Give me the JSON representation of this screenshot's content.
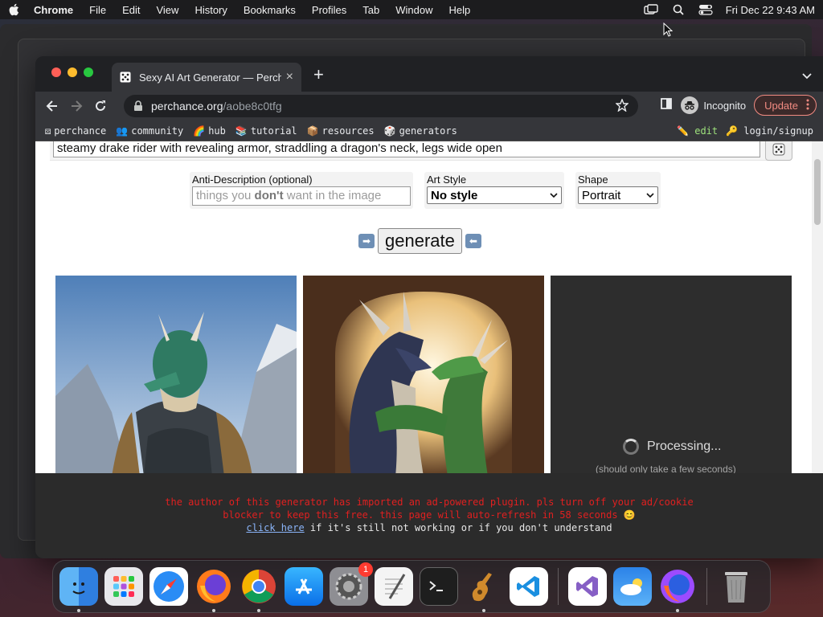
{
  "menubar": {
    "app_name": "Chrome",
    "items": [
      "File",
      "Edit",
      "View",
      "History",
      "Bookmarks",
      "Profiles",
      "Tab",
      "Window",
      "Help"
    ],
    "clock": "Fri Dec 22  9:43 AM"
  },
  "browser": {
    "tab_title": "Sexy AI Art Generator — Perch",
    "url_host": "perchance.org",
    "url_path": "/aobe8c0tfg",
    "incognito_label": "Incognito",
    "update_label": "Update"
  },
  "bookmarks": {
    "items": [
      {
        "emoji": "⚄",
        "label": "perchance"
      },
      {
        "emoji": "👥",
        "label": "community"
      },
      {
        "emoji": "🌈",
        "label": "hub"
      },
      {
        "emoji": "📚",
        "label": "tutorial"
      },
      {
        "emoji": "📦",
        "label": "resources"
      },
      {
        "emoji": "🎲",
        "label": "generators"
      }
    ],
    "edit": "✏️ edit",
    "login": "🔑 login/signup"
  },
  "page": {
    "prompt_value": "steamy drake rider with revealing armor, straddling a dragon's neck, legs wide open",
    "anti_label": "Anti-Description (optional)",
    "anti_placeholder_before": "things you ",
    "anti_placeholder_bold": "don't",
    "anti_placeholder_after": " want in the image",
    "style_label": "Art Style",
    "style_value": "No style",
    "shape_label": "Shape",
    "shape_value": "Portrait",
    "generate_label": "generate",
    "processing_label": "Processing...",
    "processing_sub": "(should only take a few seconds)"
  },
  "notice": {
    "line1": "the author of this generator has imported an ad-powered plugin. pls turn off your ad/cookie",
    "line2": "blocker to keep this free. this page will auto-refresh in 58 seconds 😊",
    "link": "click here",
    "line3_rest": " if it's still not working or if you don't understand"
  },
  "dock": {
    "apps": [
      "finder-icon",
      "launchpad-icon",
      "safari-icon",
      "firefox-icon",
      "chrome-icon",
      "app-store-icon",
      "system-settings-icon",
      "textedit-icon",
      "terminal-icon",
      "garageband-icon",
      "vscode-icon",
      "visual-studio-icon",
      "weather-icon",
      "firefox-dev-icon",
      "trash-icon"
    ],
    "settings_badge": "1"
  }
}
